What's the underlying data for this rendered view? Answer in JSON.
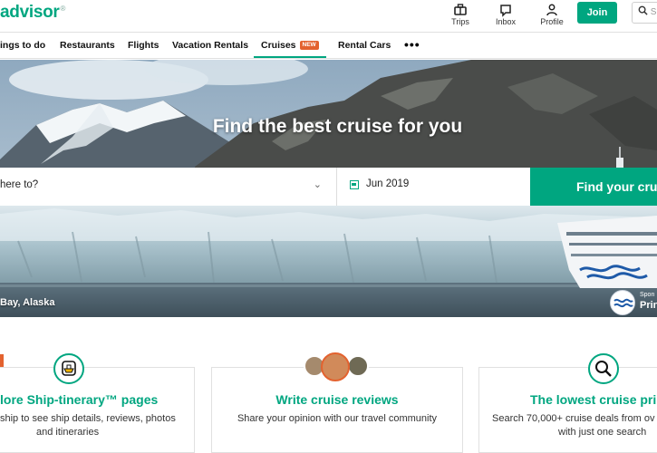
{
  "header": {
    "logo_text": "advisor",
    "logo_mark": "®",
    "trips_label": "Trips",
    "inbox_label": "Inbox",
    "profile_label": "Profile",
    "join_label": "Join",
    "search_placeholder": "S",
    "accent_color": "#00a680"
  },
  "nav": {
    "items": [
      {
        "label": "ings to do"
      },
      {
        "label": "Restaurants"
      },
      {
        "label": "Flights"
      },
      {
        "label": "Vacation Rentals"
      },
      {
        "label": "Cruises",
        "badge": "NEW",
        "active": true
      },
      {
        "label": "Rental Cars"
      }
    ],
    "more_label": "•••"
  },
  "hero": {
    "title": "Find the best cruise for you",
    "destination_placeholder": "here to?",
    "date_value": "Jun 2019",
    "find_button": "Find your cru",
    "caption": "Bay, Alaska",
    "sponsor_label": "Spon",
    "sponsor_brand": "Prin"
  },
  "cards": [
    {
      "title": "lore Ship-tinerary™ pages",
      "desc_line1": "ship to see ship details, reviews, photos",
      "desc_line2": "and itineraries",
      "icon": "ship-badge-icon"
    },
    {
      "title": "Write cruise reviews",
      "desc_line1": "Share your opinion with our travel community",
      "desc_line2": "",
      "icon": "reviewer-avatars"
    },
    {
      "title": "The lowest cruise pri",
      "desc_line1": "Search 70,000+ cruise deals from ov",
      "desc_line2": "with just one search",
      "icon": "magnifier-icon"
    }
  ]
}
